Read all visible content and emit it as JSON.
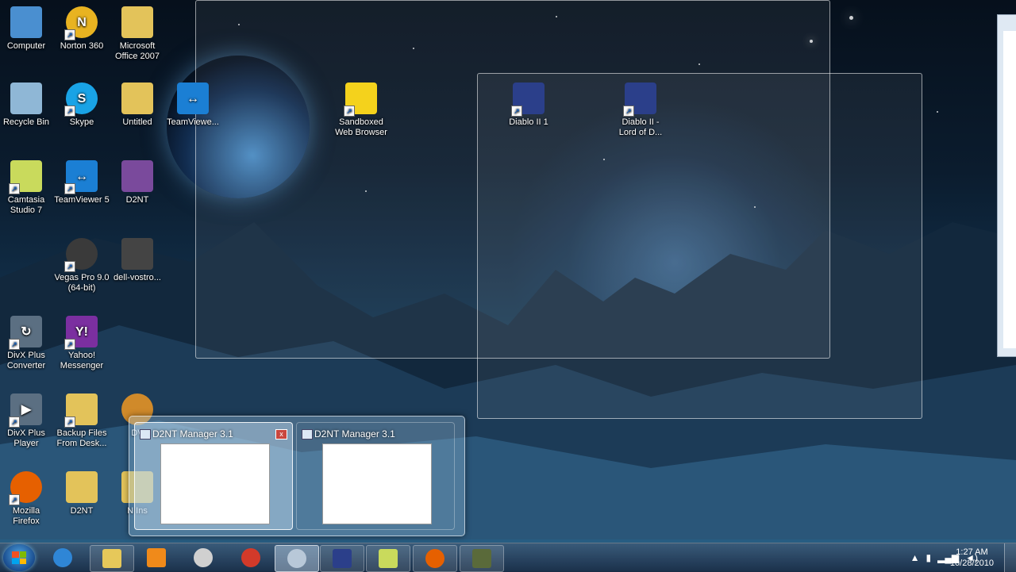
{
  "desktop": {
    "icons": [
      {
        "label": "Computer",
        "icon": "computer-icon",
        "color": "#4a8fd0"
      },
      {
        "label": "Norton 360",
        "icon": "norton-icon",
        "color": "#e8b321"
      },
      {
        "label": "Microsoft Office 2007",
        "icon": "folder-icon",
        "color": "#e3c35a"
      },
      {
        "label": "Recycle Bin",
        "icon": "recycle-bin-icon",
        "color": "#8fb7d6"
      },
      {
        "label": "Skype",
        "icon": "skype-icon",
        "color": "#19a3e6"
      },
      {
        "label": "Untitled",
        "icon": "folder-icon",
        "color": "#e3c35a"
      },
      {
        "label": "TeamViewe...",
        "icon": "teamviewer-icon",
        "color": "#1b7fd4"
      },
      {
        "label": "Sandboxed Web Browser",
        "icon": "sandboxie-icon",
        "color": "#f4d21c"
      },
      {
        "label": "Camtasia Studio 7",
        "icon": "camtasia-icon",
        "color": "#c9da5c"
      },
      {
        "label": "TeamViewer 5",
        "icon": "teamviewer-icon",
        "color": "#1b7fd4"
      },
      {
        "label": "D2NT",
        "icon": "winrar-icon",
        "color": "#7a4a9c"
      },
      {
        "label": "Vegas Pro 9.0 (64-bit)",
        "icon": "vegas-icon",
        "color": "#3a3a3a"
      },
      {
        "label": "dell-vostro...",
        "icon": "pc-tower-icon",
        "color": "#444444"
      },
      {
        "label": "DivX Plus Converter",
        "icon": "divx-converter-icon",
        "color": "#5b6f82"
      },
      {
        "label": "Yahoo! Messenger",
        "icon": "yahoo-messenger-icon",
        "color": "#7b2fa0"
      },
      {
        "label": "DivX Plus Player",
        "icon": "divx-player-icon",
        "color": "#5b6f82"
      },
      {
        "label": "Backup Files From Desk...",
        "icon": "folder-icon",
        "color": "#e3c35a"
      },
      {
        "label": "DV",
        "icon": "dvd-icon",
        "color": "#d08a2a"
      },
      {
        "label": "Mozilla Firefox",
        "icon": "firefox-icon",
        "color": "#e66000"
      },
      {
        "label": "D2NT",
        "icon": "folder-icon",
        "color": "#e3c35a"
      },
      {
        "label": "N Ins",
        "icon": "installer-icon",
        "color": "#e3c35a"
      },
      {
        "label": "Diablo II 1",
        "icon": "diablo-icon",
        "color": "#2b3f8a"
      },
      {
        "label": "Diablo II - Lord of D...",
        "icon": "diablo-icon",
        "color": "#2b3f8a"
      }
    ]
  },
  "thumbnails": [
    {
      "title": "D2NT Manager 3.1",
      "close": "x"
    },
    {
      "title": "D2NT Manager 3.1"
    }
  ],
  "taskbar": {
    "buttons": [
      {
        "name": "internet-explorer",
        "icon": "ie-icon",
        "color": "#2f86d6"
      },
      {
        "name": "windows-explorer",
        "icon": "explorer-folder-icon",
        "color": "#e6c85a"
      },
      {
        "name": "media-player",
        "icon": "media-player-icon",
        "color": "#f08a1a"
      },
      {
        "name": "clock-app",
        "icon": "clock-icon",
        "color": "#d0d0d0"
      },
      {
        "name": "pushpin-app",
        "icon": "pushpin-icon",
        "color": "#d23a2a"
      },
      {
        "name": "d2nt-manager",
        "icon": "d2nt-gear-icon",
        "color": "#b8c8d8"
      },
      {
        "name": "diablo",
        "icon": "diablo-icon",
        "color": "#2b3f8a"
      },
      {
        "name": "camtasia",
        "icon": "camtasia-icon",
        "color": "#c9da5c"
      },
      {
        "name": "firefox",
        "icon": "firefox-icon",
        "color": "#e66000"
      },
      {
        "name": "recorder",
        "icon": "camera-icon",
        "color": "#5a6a3a"
      }
    ],
    "time": "1:27 AM",
    "date": "10/28/2010"
  }
}
